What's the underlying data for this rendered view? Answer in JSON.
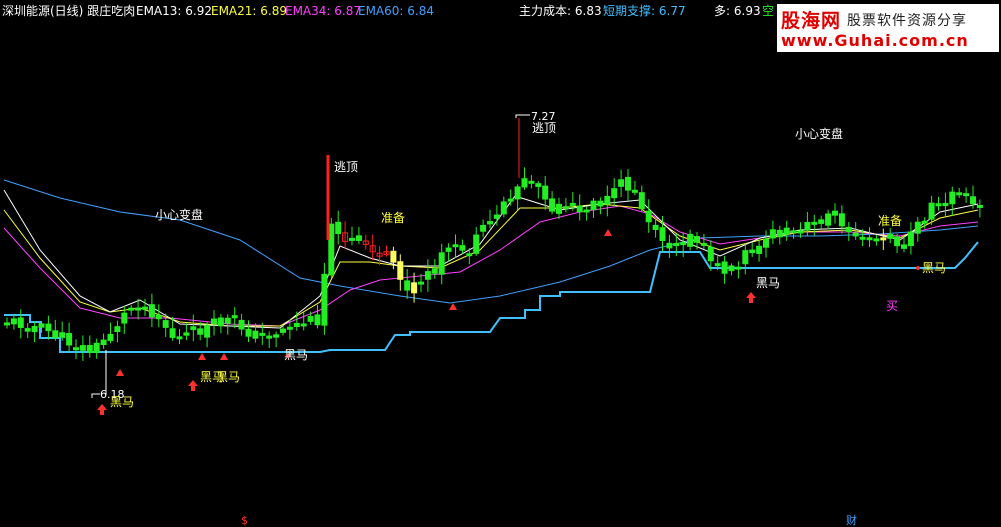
{
  "header": {
    "title": "深圳能源(日线)",
    "indicator": "跟庄吃肉",
    "ema13_label": "EMA13:",
    "ema13_value": "6.92",
    "ema21_label": "EMA21:",
    "ema21_value": "6.89",
    "ema34_label": "EMA34:",
    "ema34_value": "6.87",
    "ema60_label": "EMA60:",
    "ema60_value": "6.84",
    "cost_label": "主力成本:",
    "cost_value": "6.83",
    "support_label": "短期支撑:",
    "support_value": "6.77",
    "long_label": "多:",
    "long_value": "6.93",
    "short_label": "空"
  },
  "watermark": {
    "logo": "股海网",
    "tagline": "股票软件资源分享",
    "url": "www.Guhai.com.cn"
  },
  "colors": {
    "background": "#000000",
    "candle_up": "#ff2020",
    "candle_down": "#22ee22",
    "candle_special": "#ffff60",
    "ema13": "#ffffff",
    "ema21": "#ffff40",
    "ema34": "#ff40ff",
    "ema60": "#40a0ff",
    "support": "#40c0ff",
    "signal_arrow": "#ff3030",
    "text_label": "#ffff40",
    "text_white": "#ffffff",
    "text_magenta": "#ff40ff"
  },
  "chart_data": {
    "type": "candlestick",
    "annotations": {
      "high_price": "7.27",
      "low_price": "6.18",
      "top_escape_1": "逃顶",
      "top_escape_2": "逃顶",
      "careful_1": "小心变盘",
      "careful_2": "小心变盘",
      "prepare_1": "准备",
      "prepare_2": "准备",
      "darkhorse_1": "黑马",
      "darkhorse_2": "黑马",
      "darkhorse_3": "黑马",
      "darkhorse_4": "黑马",
      "darkhorse_5": "黑马",
      "darkhorse_6": "黑马",
      "buy": "买",
      "bottom_dollar": "$",
      "bottom_cai": "财"
    }
  }
}
